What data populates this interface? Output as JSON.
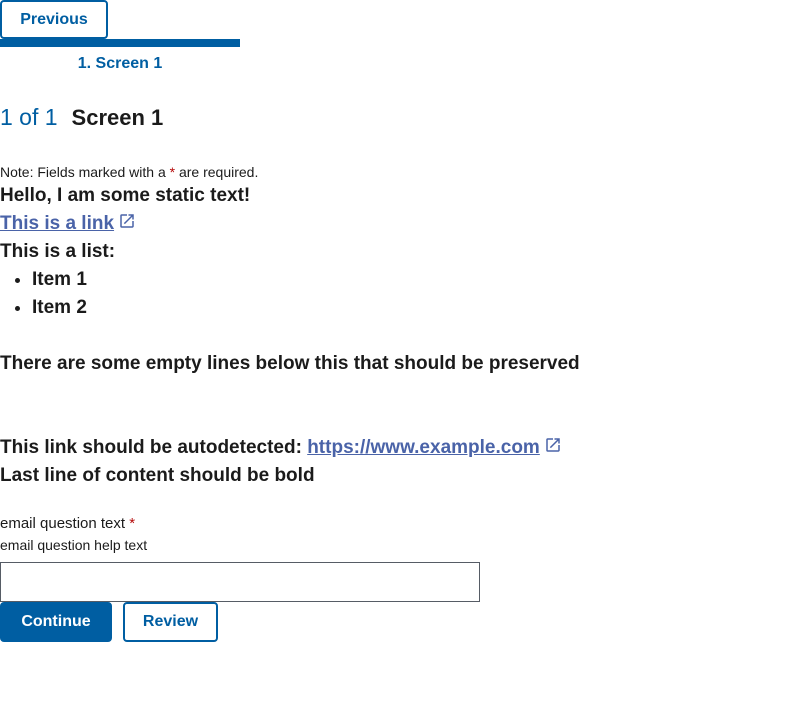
{
  "nav": {
    "previous_label": "Previous"
  },
  "progress": {
    "steps": [
      {
        "label": "1. Screen 1",
        "active": true
      }
    ],
    "current_step": 1,
    "total_steps": 1
  },
  "screen": {
    "counter": "1 of 1",
    "title": "Screen 1"
  },
  "form_note": {
    "prefix": "Note: Fields marked with a ",
    "asterisk": "*",
    "suffix": " are required."
  },
  "static_content": {
    "greeting": "Hello, I am some static text!",
    "link_text": "This is a link",
    "list_intro": "This is a list:",
    "list_items": [
      "Item 1",
      "Item 2"
    ],
    "empty_lines_text": "There are some empty lines below this that should be preserved",
    "autodetect_prefix": "This link should be autodetected: ",
    "autodetect_url": "https://www.example.com",
    "last_line": "Last line of content should be bold"
  },
  "email_question": {
    "label": "email question text",
    "required_marker": "*",
    "help_text": "email question help text",
    "value": ""
  },
  "actions": {
    "continue_label": "Continue",
    "review_label": "Review"
  },
  "colors": {
    "primary": "#005ea2",
    "link": "#4a63a8",
    "required": "#b50909",
    "text": "#1b1b1b"
  },
  "icons": {
    "external_link": "external-link-icon"
  }
}
